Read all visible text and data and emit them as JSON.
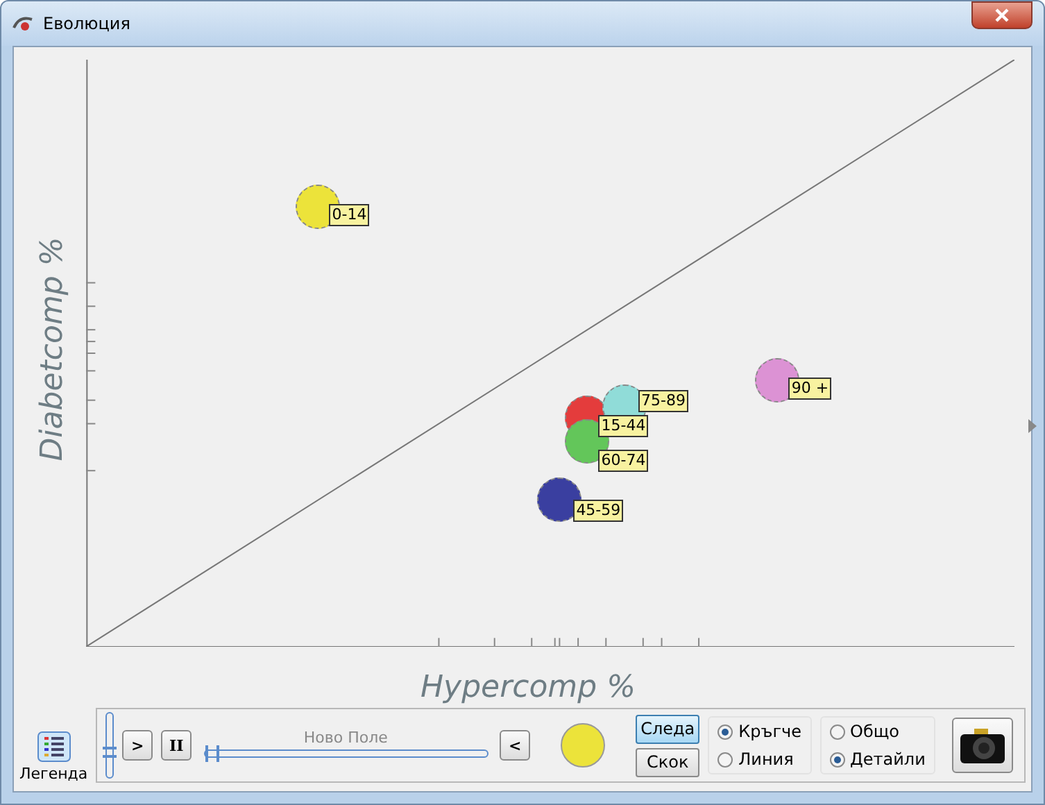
{
  "window": {
    "title": "Еволюция"
  },
  "chart": {
    "ylabel": "Diabetcomp %",
    "xlabel": "Hypercomp %",
    "bubbles": [
      {
        "label": "0-14",
        "color": "#ece33a"
      },
      {
        "label": "15-44",
        "color": "#e43c3c"
      },
      {
        "label": "45-59",
        "color": "#3a3fa0"
      },
      {
        "label": "60-74",
        "color": "#63c65a"
      },
      {
        "label": "75-89",
        "color": "#90dcd8"
      },
      {
        "label": "90 +",
        "color": "#dc92d4"
      }
    ]
  },
  "controls": {
    "legend": "Легенда",
    "vertical_slider": {
      "level": 0.4
    },
    "play": ">",
    "pause": "II",
    "field_label": "Ново Поле",
    "time_slider": {
      "level": 0
    },
    "back": "<",
    "swatch": {
      "color": "#ece33a"
    },
    "trail_buttons": [
      {
        "label": "Следа",
        "pressed": true
      },
      {
        "label": "Скок",
        "pressed": false
      }
    ],
    "shape_options": [
      {
        "label": "Кръгче",
        "selected": true
      },
      {
        "label": "Линия",
        "selected": false
      }
    ],
    "view_options": [
      {
        "label": "Общо",
        "selected": false
      },
      {
        "label": "Детайли",
        "selected": true
      }
    ]
  }
}
